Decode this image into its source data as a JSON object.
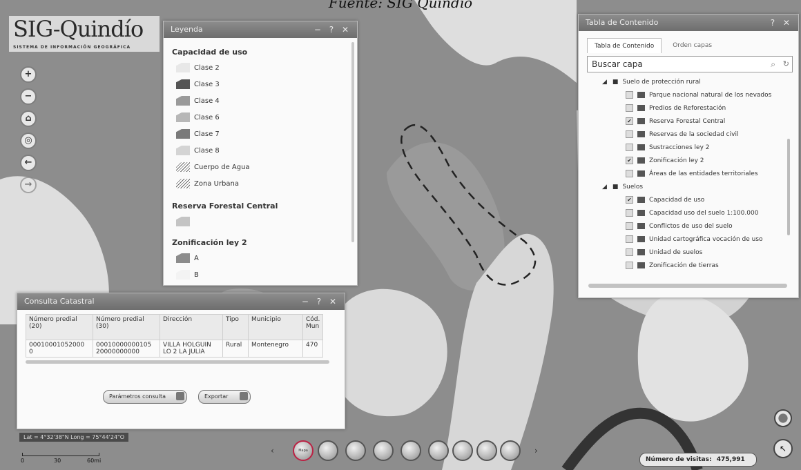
{
  "caption": "Fuente: SIG Quindío",
  "logo": {
    "title": "SIG-Quindío",
    "subtitle": "SISTEMA DE INFORMACIÓN GEOGRÁFICA"
  },
  "nav_buttons": [
    "+",
    "−",
    "⌂",
    "◎",
    "←",
    "→"
  ],
  "legend": {
    "title": "Leyenda",
    "controls": "− ? ✕",
    "section1_title": "Capacidad de uso",
    "section1_items": [
      "Clase 2",
      "Clase 3",
      "Clase 4",
      "Clase 6",
      "Clase 7",
      "Clase 8",
      "Cuerpo de Agua",
      "Zona Urbana"
    ],
    "section2_title": "Reserva Forestal Central",
    "section3_title": "Zonificación ley 2",
    "section3_items": [
      "A",
      "B"
    ]
  },
  "toc": {
    "title": "Tabla de Contenido",
    "controls": "? ✕",
    "tab_active": "Tabla de Contenido",
    "tab_inactive": "Orden capas",
    "search_placeholder": "Buscar capa",
    "group1": "Suelo de protección rural",
    "group1_items": [
      {
        "label": "Parque nacional natural de los nevados",
        "checked": false
      },
      {
        "label": "Predios de Reforestación",
        "checked": false
      },
      {
        "label": "Reserva Forestal Central",
        "checked": true
      },
      {
        "label": "Reservas de la sociedad civil",
        "checked": false
      },
      {
        "label": "Sustracciones ley 2",
        "checked": false
      },
      {
        "label": "Zonificación ley 2",
        "checked": true
      },
      {
        "label": "Áreas de las entidades territoriales",
        "checked": false
      }
    ],
    "group2": "Suelos",
    "group2_items": [
      {
        "label": "Capacidad de uso",
        "checked": true
      },
      {
        "label": "Capacidad uso del suelo 1:100.000",
        "checked": false
      },
      {
        "label": "Conflictos de uso del suelo",
        "checked": false
      },
      {
        "label": "Unidad cartográfica vocación de uso",
        "checked": false
      },
      {
        "label": "Unidad de suelos",
        "checked": false
      },
      {
        "label": "Zonificación de tierras",
        "checked": false
      }
    ]
  },
  "catastral": {
    "title": "Consulta Catastral",
    "controls": "− ? ✕",
    "headers": [
      "Número predial (20)",
      "Número predial (30)",
      "Dirección",
      "Tipo",
      "Municipio",
      "Cód. Mun"
    ],
    "row": [
      "00010001052000 0",
      "00010000000105 20000000000",
      "VILLA HOLGUIN LO 2 LA JULIA",
      "Rural",
      "Montenegro",
      "470"
    ],
    "btn_params": "Parámetros consulta",
    "btn_export": "Exportar"
  },
  "coords": "Lat = 4°32'38\"N Long = 75°44'24\"O",
  "scale": [
    "0",
    "30",
    "60mi"
  ],
  "bottom_tools": [
    "Mapa",
    "",
    "",
    "",
    "",
    "",
    "",
    "",
    ""
  ],
  "visits": {
    "label": "Número de visitas:",
    "value": "475,991"
  }
}
